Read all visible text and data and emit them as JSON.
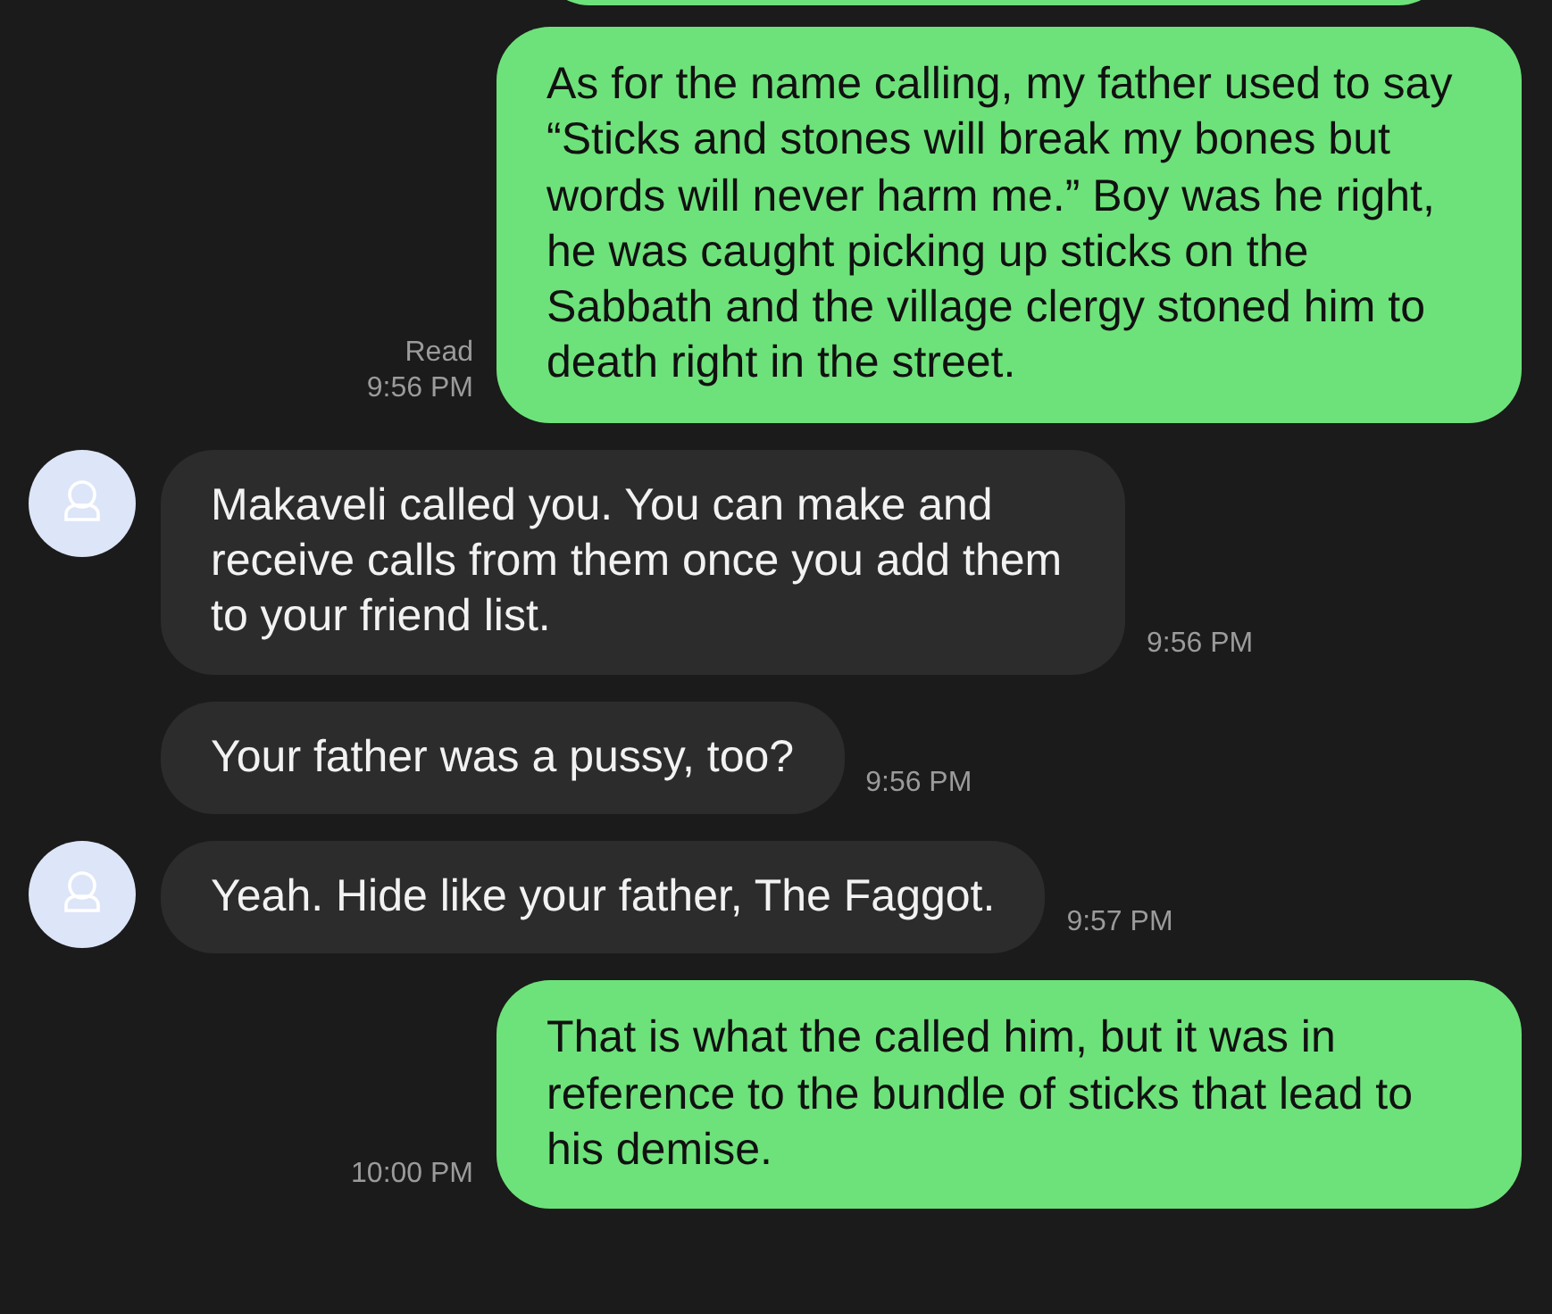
{
  "top_bubble_cut": true,
  "messages": [
    {
      "kind": "out",
      "status": "Read",
      "time": "9:56 PM",
      "text": "As for the name calling, my father used to say “Sticks and stones will break my bones but words will never harm me.” Boy was he right, he was caught picking up sticks on the Sabbath and the village clergy stoned him to death right in the street."
    },
    {
      "kind": "in",
      "avatar": true,
      "time": "9:56 PM",
      "text": "Makaveli called you. You can make and receive calls from them once you add them to your friend list."
    },
    {
      "kind": "in",
      "avatar": false,
      "time": "9:56 PM",
      "text": "Your father was a pussy, too?"
    },
    {
      "kind": "in",
      "avatar": true,
      "time": "9:57 PM",
      "text": "Yeah. Hide like your father, The Faggot."
    },
    {
      "kind": "out",
      "time": "10:00 PM",
      "text": "That is what the called him, but it was in reference to the bundle of sticks that lead to his demise."
    }
  ]
}
